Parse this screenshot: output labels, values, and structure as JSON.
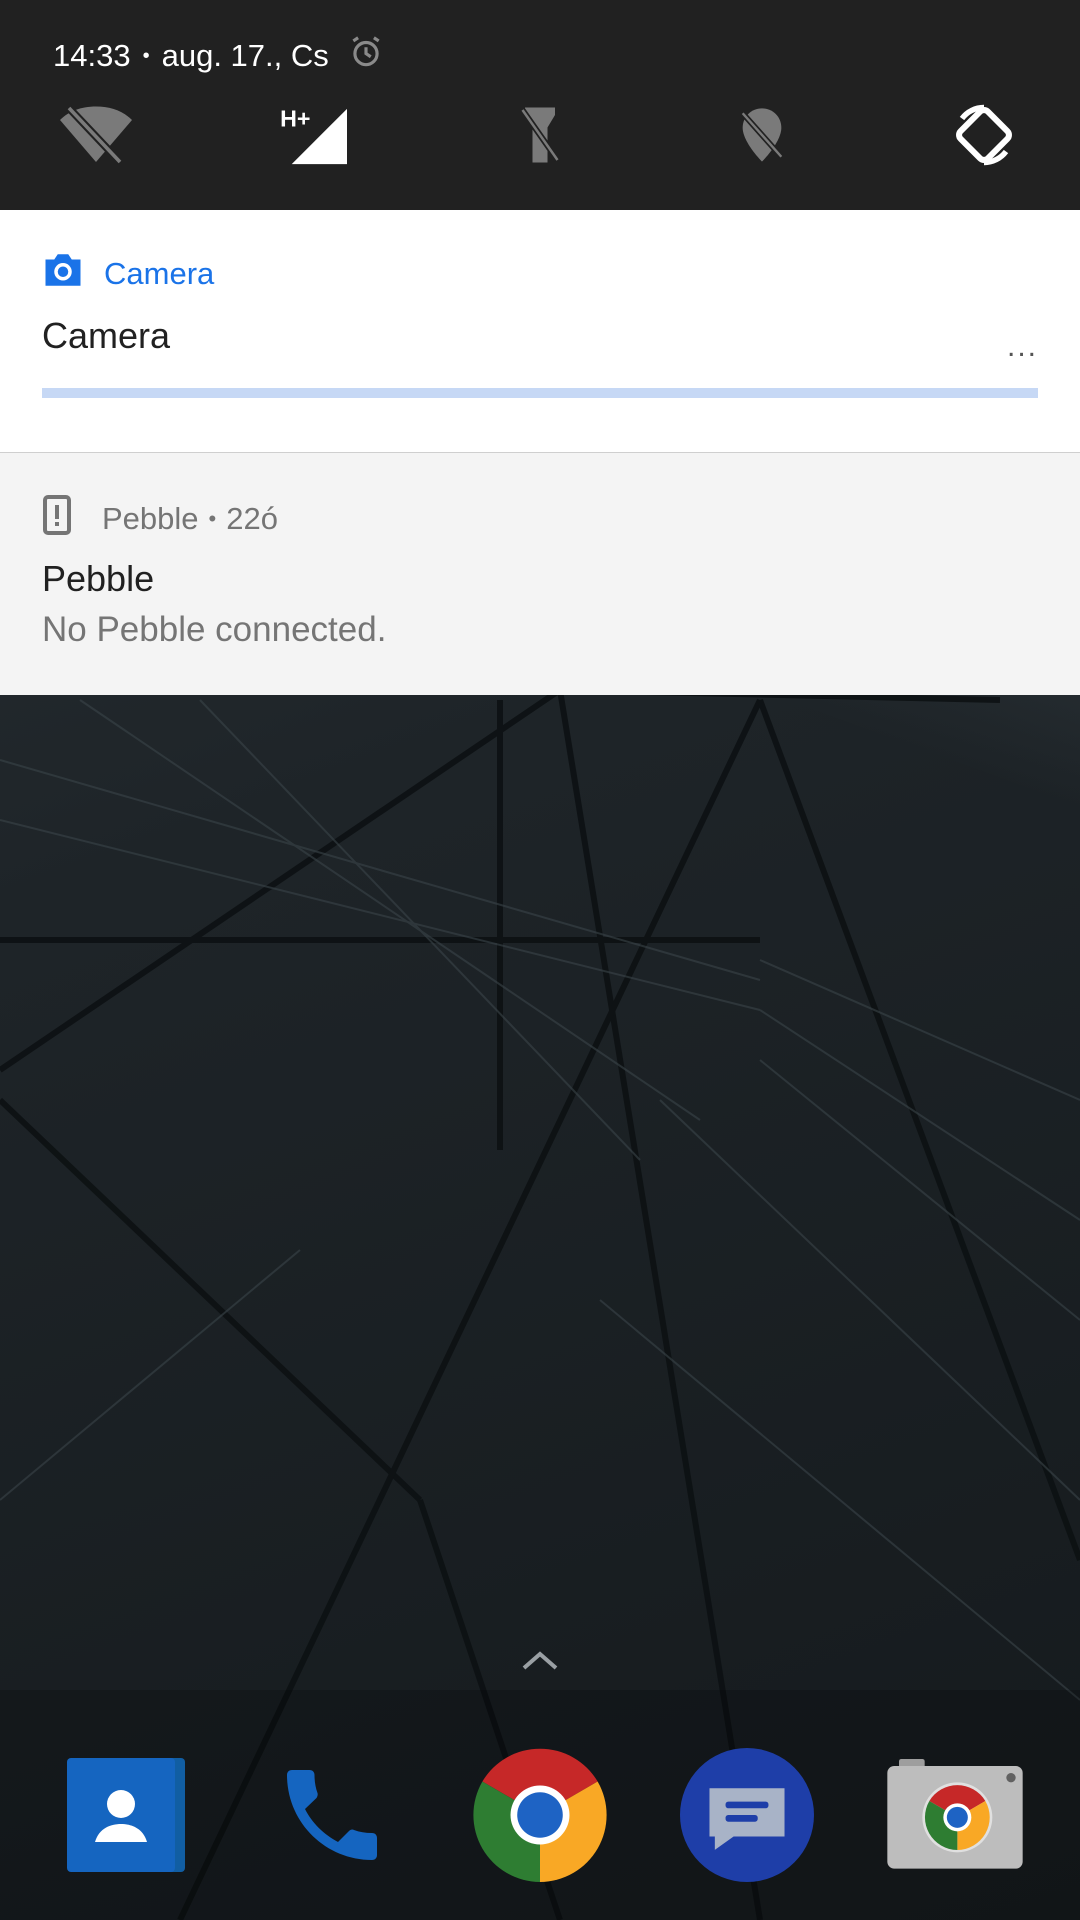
{
  "status": {
    "time": "14:33",
    "separator": "•",
    "date": "aug. 17., Cs",
    "alarm_icon": "alarm-icon"
  },
  "quick_settings": [
    {
      "name": "wifi-off-icon"
    },
    {
      "name": "mobile-data-icon",
      "label": "H+"
    },
    {
      "name": "flashlight-off-icon"
    },
    {
      "name": "location-off-icon"
    },
    {
      "name": "auto-rotate-icon"
    }
  ],
  "notifications": {
    "camera": {
      "app_name": "Camera",
      "title": "Camera",
      "overflow": "...",
      "progress": 0,
      "accent": "#1a73e8"
    },
    "pebble": {
      "app_name": "Pebble",
      "separator": "•",
      "time": "22ó",
      "title": "Pebble",
      "text": "No Pebble connected."
    }
  },
  "dock": {
    "apps": [
      {
        "name": "contacts-app-icon"
      },
      {
        "name": "phone-app-icon"
      },
      {
        "name": "chrome-app-icon"
      },
      {
        "name": "messages-app-icon"
      },
      {
        "name": "camera-app-icon"
      }
    ]
  }
}
